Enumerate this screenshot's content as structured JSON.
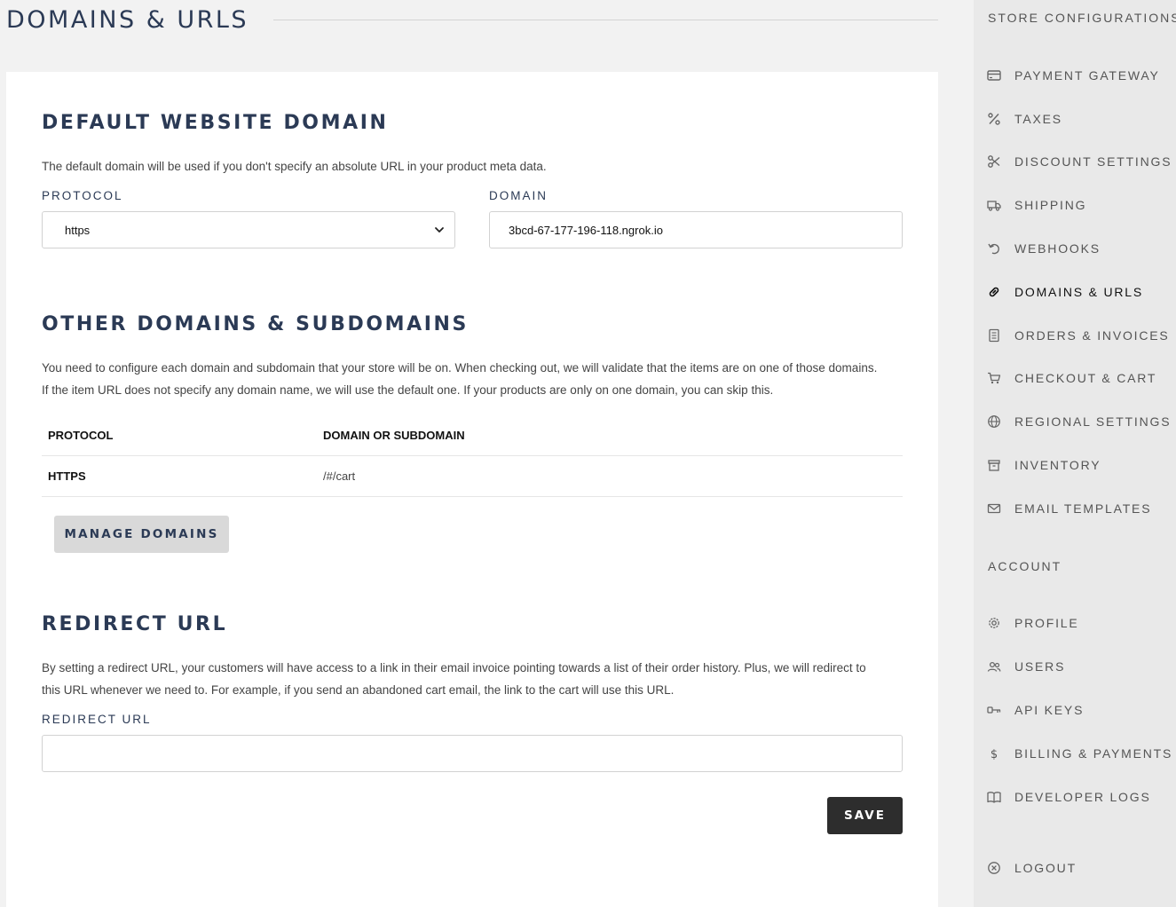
{
  "header": {
    "title": "DOMAINS & URLS"
  },
  "default_domain": {
    "heading": "DEFAULT WEBSITE DOMAIN",
    "description": "The default domain will be used if you don't specify an absolute URL in your product meta data.",
    "protocol_label": "PROTOCOL",
    "protocol_value": "https",
    "domain_label": "DOMAIN",
    "domain_value": "3bcd-67-177-196-118.ngrok.io"
  },
  "other_domains": {
    "heading": "OTHER DOMAINS & SUBDOMAINS",
    "description_line1": "You need to configure each domain and subdomain that your store will be on. When checking out, we will validate that the items are on one of those domains.",
    "description_line2": "If the item URL does not specify any domain name, we will use the default one. If your products are only on one domain, you can skip this.",
    "table_headers": [
      "PROTOCOL",
      "DOMAIN OR SUBDOMAIN"
    ],
    "rows": [
      {
        "protocol": "HTTPS",
        "domain": "/#/cart"
      }
    ],
    "manage_button": "MANAGE DOMAINS"
  },
  "redirect": {
    "heading": "REDIRECT URL",
    "description_line1": "By setting a redirect URL, your customers will have access to a link in their email invoice pointing towards a list of their order history. Plus, we will redirect to",
    "description_line2": "this URL whenever we need to. For example, if you send an abandoned cart email, the link to the cart will use this URL.",
    "field_label": "REDIRECT URL",
    "field_value": "",
    "save_button": "SAVE"
  },
  "sidebar": {
    "store_heading": "STORE CONFIGURATIONS",
    "store_items": [
      {
        "label": "PAYMENT GATEWAY",
        "icon": "credit-card-icon"
      },
      {
        "label": "TAXES",
        "icon": "percent-icon"
      },
      {
        "label": "DISCOUNT SETTINGS",
        "icon": "scissors-icon"
      },
      {
        "label": "SHIPPING",
        "icon": "truck-icon"
      },
      {
        "label": "WEBHOOKS",
        "icon": "undo-arrow-icon"
      },
      {
        "label": "DOMAINS & URLS",
        "icon": "link-icon",
        "active": true
      },
      {
        "label": "ORDERS & INVOICES",
        "icon": "receipt-icon"
      },
      {
        "label": "CHECKOUT & CART",
        "icon": "cart-icon"
      },
      {
        "label": "REGIONAL SETTINGS",
        "icon": "globe-icon"
      },
      {
        "label": "INVENTORY",
        "icon": "box-icon"
      },
      {
        "label": "EMAIL TEMPLATES",
        "icon": "envelope-icon"
      }
    ],
    "account_heading": "ACCOUNT",
    "account_items": [
      {
        "label": "PROFILE",
        "icon": "gear-icon"
      },
      {
        "label": "USERS",
        "icon": "users-icon"
      },
      {
        "label": "API KEYS",
        "icon": "key-icon"
      },
      {
        "label": "BILLING & PAYMENTS",
        "icon": "dollar-icon"
      },
      {
        "label": "DEVELOPER LOGS",
        "icon": "book-icon"
      }
    ],
    "logout": {
      "label": "LOGOUT",
      "icon": "close-circle-icon"
    }
  }
}
